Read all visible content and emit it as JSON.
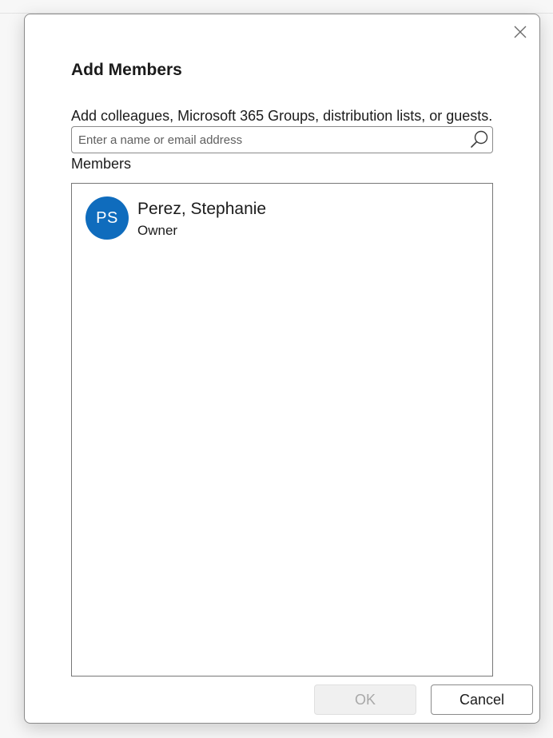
{
  "dialog": {
    "title": "Add Members",
    "close_icon": "close-icon",
    "instructions": "Add colleagues, Microsoft 365 Groups, distribution lists, or guests.",
    "search": {
      "placeholder": "Enter a name or email address",
      "value": "",
      "icon": "search-icon"
    },
    "members_label": "Members",
    "members": [
      {
        "initials": "PS",
        "name": "Perez, Stephanie",
        "role": "Owner",
        "avatar_color": "#0f6cbd"
      }
    ],
    "buttons": {
      "ok_label": "OK",
      "ok_enabled": false,
      "cancel_label": "Cancel"
    }
  }
}
